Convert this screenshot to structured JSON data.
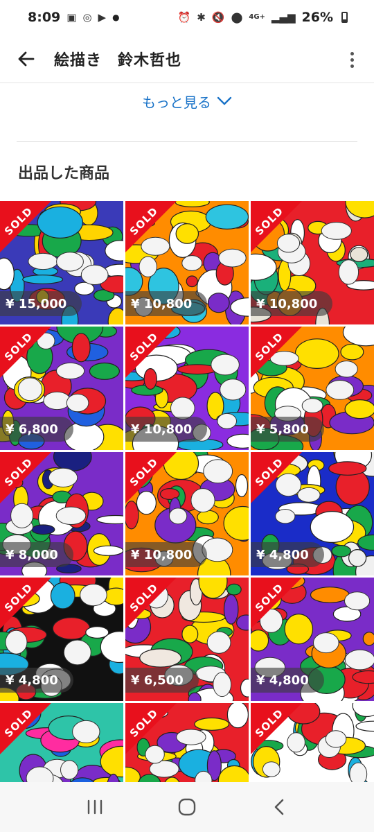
{
  "status": {
    "time": "8:09",
    "network": "4G+",
    "battery": "26%"
  },
  "header": {
    "title": "絵描き　鈴木哲也"
  },
  "see_more": {
    "label": "もっと見る"
  },
  "section": {
    "title": "出品した商品"
  },
  "sold_label": "SOLD",
  "items": [
    {
      "price": "¥ 15,000",
      "palette": [
        "#3a3ab8",
        "#ffd400",
        "#e8202a",
        "#18a84a",
        "#ffffff",
        "#1ab0e0"
      ]
    },
    {
      "price": "¥ 10,800",
      "palette": [
        "#ff8c00",
        "#2ec4e0",
        "#e8202a",
        "#7a2cc8",
        "#ffe000",
        "#ffffff"
      ]
    },
    {
      "price": "¥ 10,800",
      "palette": [
        "#e8202a",
        "#ffe000",
        "#1ab07a",
        "#ffffff",
        "#ff8c00",
        "#e8e4d8"
      ]
    },
    {
      "price": "¥ 6,800",
      "palette": [
        "#7a2cc8",
        "#ffe000",
        "#e8202a",
        "#18a84a",
        "#ffffff",
        "#2060e0"
      ]
    },
    {
      "price": "¥ 10,800",
      "palette": [
        "#8a2ce0",
        "#e8202a",
        "#ffe000",
        "#1ab0e0",
        "#ffffff",
        "#18a84a"
      ]
    },
    {
      "price": "¥ 5,800",
      "palette": [
        "#ff8c00",
        "#18a84a",
        "#e8202a",
        "#ffe000",
        "#7a2cc8",
        "#ffffff"
      ]
    },
    {
      "price": "¥ 8,000",
      "palette": [
        "#7a2cc8",
        "#e8202a",
        "#ffffff",
        "#ffe000",
        "#1a2080",
        "#18a84a"
      ]
    },
    {
      "price": "¥ 10,800",
      "palette": [
        "#ff8c00",
        "#18a84a",
        "#e8202a",
        "#ffe000",
        "#7a2cc8",
        "#ffffff"
      ]
    },
    {
      "price": "¥ 4,800",
      "palette": [
        "#1a2cc8",
        "#ffffff",
        "#e8202a",
        "#18a84a",
        "#ffe000",
        "#f0f0f0"
      ]
    },
    {
      "price": "¥ 4,800",
      "palette": [
        "#111111",
        "#ffe000",
        "#e8202a",
        "#18a84a",
        "#1ab0e0",
        "#ffffff"
      ]
    },
    {
      "price": "¥ 6,500",
      "palette": [
        "#e8202a",
        "#ffffff",
        "#18a84a",
        "#f0e8e0",
        "#7a2cc8",
        "#ffe000"
      ]
    },
    {
      "price": "¥ 4,800",
      "palette": [
        "#7a2cc8",
        "#e8202a",
        "#ffe000",
        "#ffffff",
        "#18a84a",
        "#ff8c00"
      ]
    },
    {
      "price": "",
      "palette": [
        "#2ec4a8",
        "#7a2cc8",
        "#ff2ca0",
        "#ffe000",
        "#1a60e0",
        "#2ec4a8"
      ]
    },
    {
      "price": "",
      "palette": [
        "#e8202a",
        "#ffe000",
        "#ffffff",
        "#18a84a",
        "#7a2cc8",
        "#1ab0e0"
      ]
    },
    {
      "price": "",
      "palette": [
        "#ffffff",
        "#1ab0e0",
        "#18a84a",
        "#e8202a",
        "#ffe000",
        "#ffffff"
      ]
    }
  ],
  "colors": {
    "accent": "#1a73c8",
    "sold": "#e8101c"
  }
}
